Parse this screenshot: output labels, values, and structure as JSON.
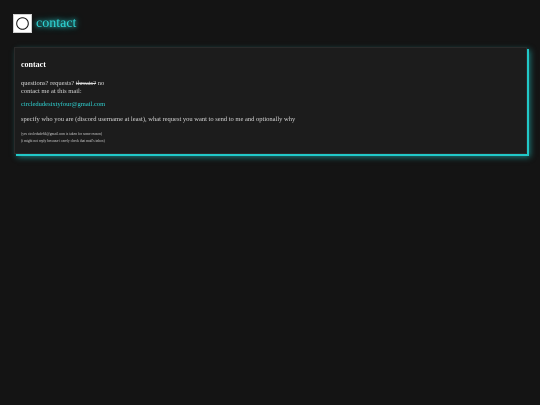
{
  "header": {
    "logo_icon": "circle-icon",
    "title": "contact"
  },
  "card": {
    "title": "contact",
    "intro": {
      "part1": "questions? requests? ",
      "struck": "threats?",
      "part2": " no",
      "line2": "contact me at this mail:"
    },
    "email": "circledudesixtyfour@gmail.com",
    "instructions": "specify who you are (discord username at least), what request you want to send to me and optionally why",
    "notes": [
      "(yes circledude64@gmail.com is taken for some reason)",
      "(i might not reply because i rarely check that mail's inbox)"
    ]
  },
  "colors": {
    "background": "#141414",
    "card": "#1c1c1c",
    "accent": "#2fd6d6"
  }
}
